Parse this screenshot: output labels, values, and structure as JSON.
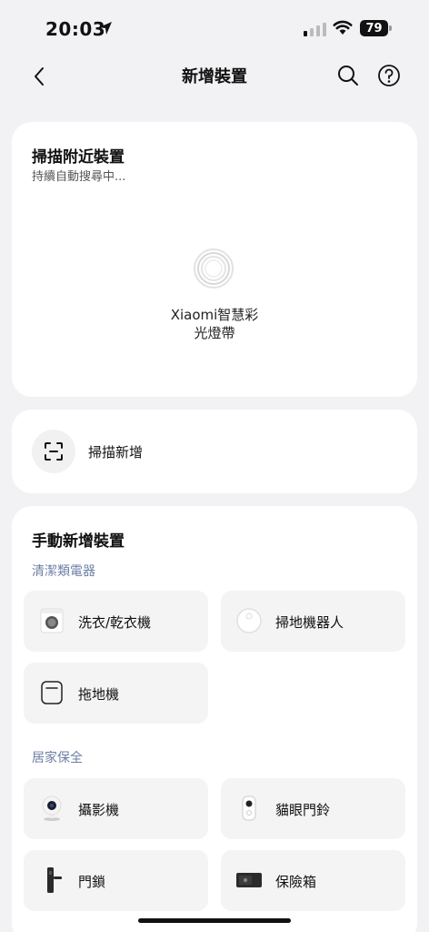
{
  "status": {
    "time": "20:03",
    "battery": "79"
  },
  "nav": {
    "title": "新增裝置"
  },
  "scan": {
    "title": "掃描附近裝置",
    "subtitle": "持續自動搜尋中...",
    "device_line1": "Xiaomi智慧彩",
    "device_line2": "光燈帶"
  },
  "qr": {
    "label": "掃描新增"
  },
  "manual": {
    "title": "手動新增裝置",
    "categories": [
      {
        "label": "清潔類電器",
        "items": [
          {
            "label": "洗衣/乾衣機",
            "icon": "washer-icon"
          },
          {
            "label": "掃地機器人",
            "icon": "robot-vacuum-icon"
          },
          {
            "label": "拖地機",
            "icon": "mop-icon"
          }
        ]
      },
      {
        "label": "居家保全",
        "items": [
          {
            "label": "攝影機",
            "icon": "camera-icon"
          },
          {
            "label": "貓眼門鈴",
            "icon": "doorbell-icon"
          },
          {
            "label": "門鎖",
            "icon": "door-lock-icon"
          },
          {
            "label": "保險箱",
            "icon": "safe-icon"
          }
        ]
      }
    ]
  }
}
